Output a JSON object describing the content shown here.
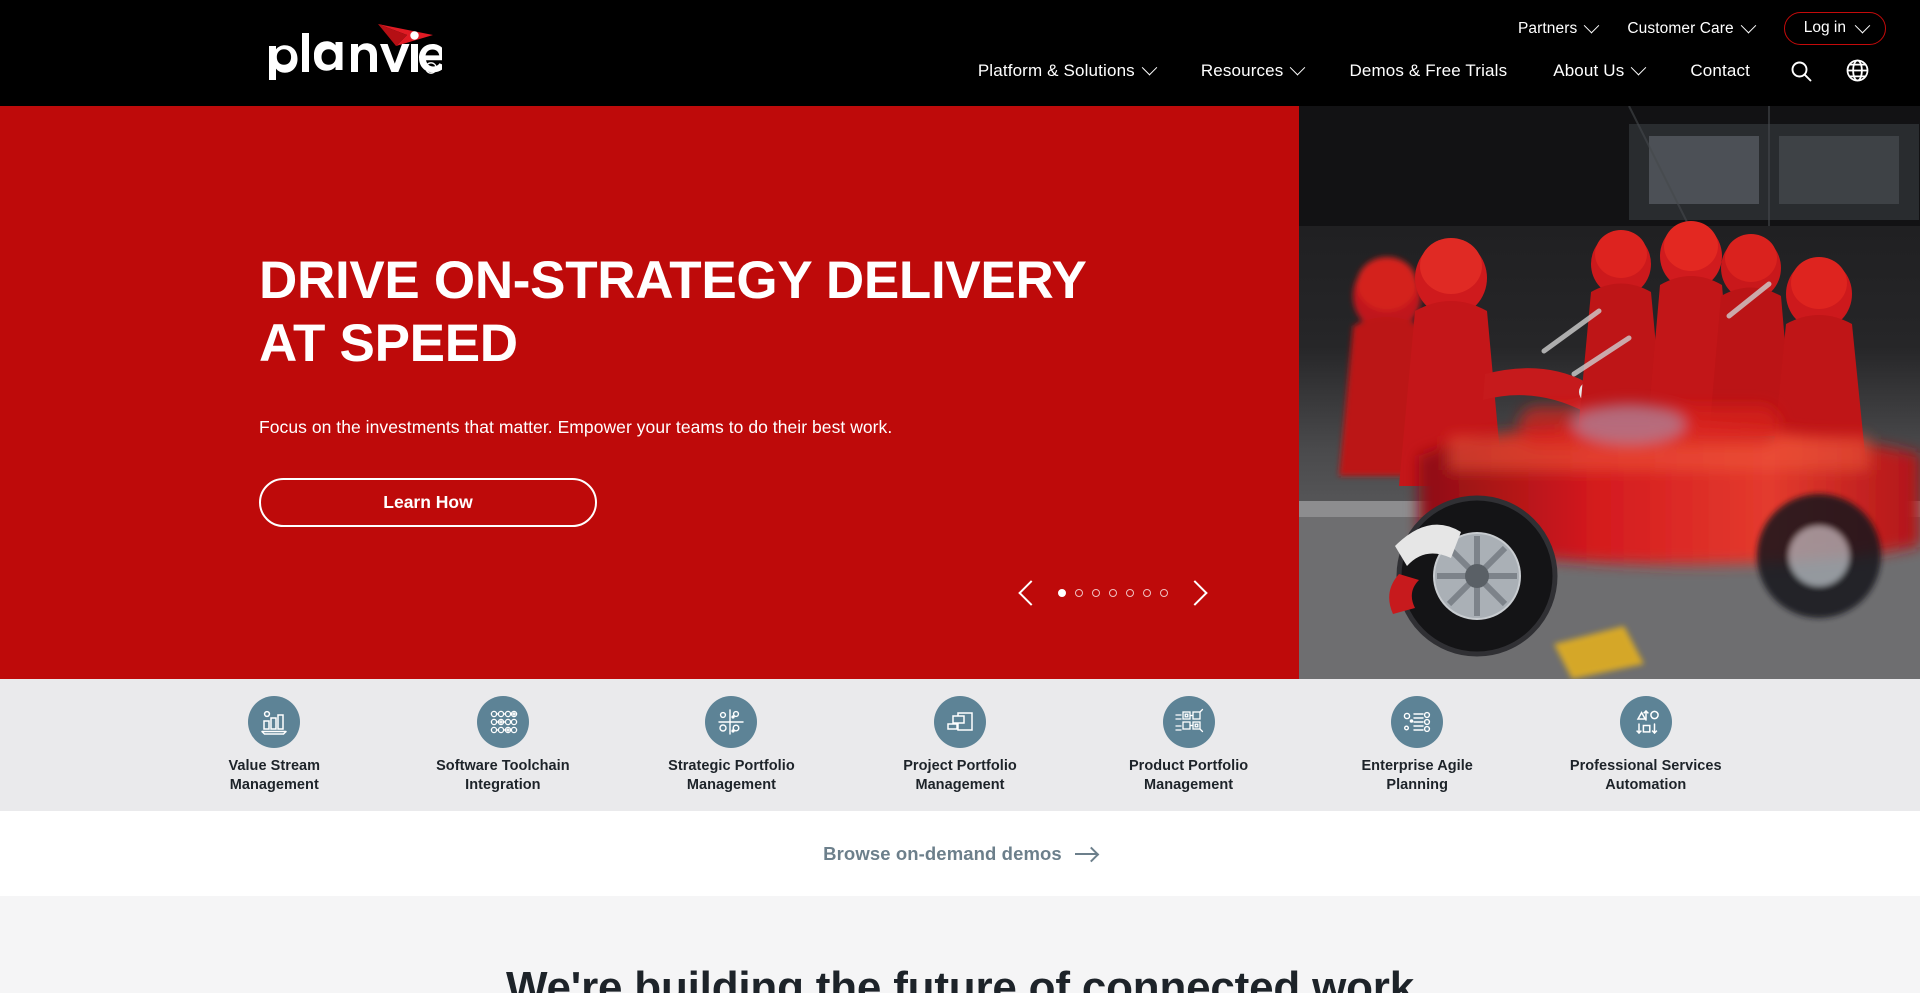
{
  "brand": {
    "logo_text": "planview",
    "logo_mark": "swoosh-icon",
    "accent_red": "#be0a0a",
    "header_bg": "#000000",
    "icon_circle": "#5d8396",
    "product_bar_bg": "#eaeaec"
  },
  "header": {
    "utility_nav": [
      {
        "label": "Partners",
        "icon": "chevron-down-icon"
      },
      {
        "label": "Customer Care",
        "icon": "chevron-down-icon"
      }
    ],
    "login": {
      "label": "Log in",
      "icon": "chevron-down-icon"
    },
    "main_nav": [
      {
        "label": "Platform & Solutions",
        "has_chevron": true
      },
      {
        "label": "Resources",
        "has_chevron": true
      },
      {
        "label": "Demos & Free Trials",
        "has_chevron": false
      },
      {
        "label": "About Us",
        "has_chevron": true
      },
      {
        "label": "Contact",
        "has_chevron": false
      }
    ],
    "search_icon": "search-icon",
    "language_icon": "globe-icon"
  },
  "hero": {
    "title_line1": "DRIVE ON-STRATEGY DELIVERY",
    "title_line2": "AT SPEED",
    "subtitle": "Focus on the investments that matter. Empower your teams to do their best work.",
    "cta_label": "Learn How",
    "carousel": {
      "prev_label": "Previous slide",
      "next_label": "Next slide",
      "total_slides": 7,
      "active_slide": 1
    },
    "image_alt": "formula-one-pit-crew-photo"
  },
  "products": [
    {
      "label": "Value Stream Management",
      "icon": "bar-chart-icon"
    },
    {
      "label": "Software Toolchain Integration",
      "icon": "nodes-grid-icon"
    },
    {
      "label": "Strategic Portfolio Management",
      "icon": "scatter-quadrant-icon"
    },
    {
      "label": "Project Portfolio Management",
      "icon": "stacked-windows-icon"
    },
    {
      "label": "Product Portfolio Management",
      "icon": "kanban-board-icon"
    },
    {
      "label": "Enterprise Agile Planning",
      "icon": "backlog-list-icon"
    },
    {
      "label": "Professional Services Automation",
      "icon": "shapes-arrows-icon"
    }
  ],
  "demos": {
    "link_label": "Browse on-demand demos",
    "icon": "arrow-right-icon"
  },
  "next_section": {
    "heading": "We're building the future of connected work"
  }
}
